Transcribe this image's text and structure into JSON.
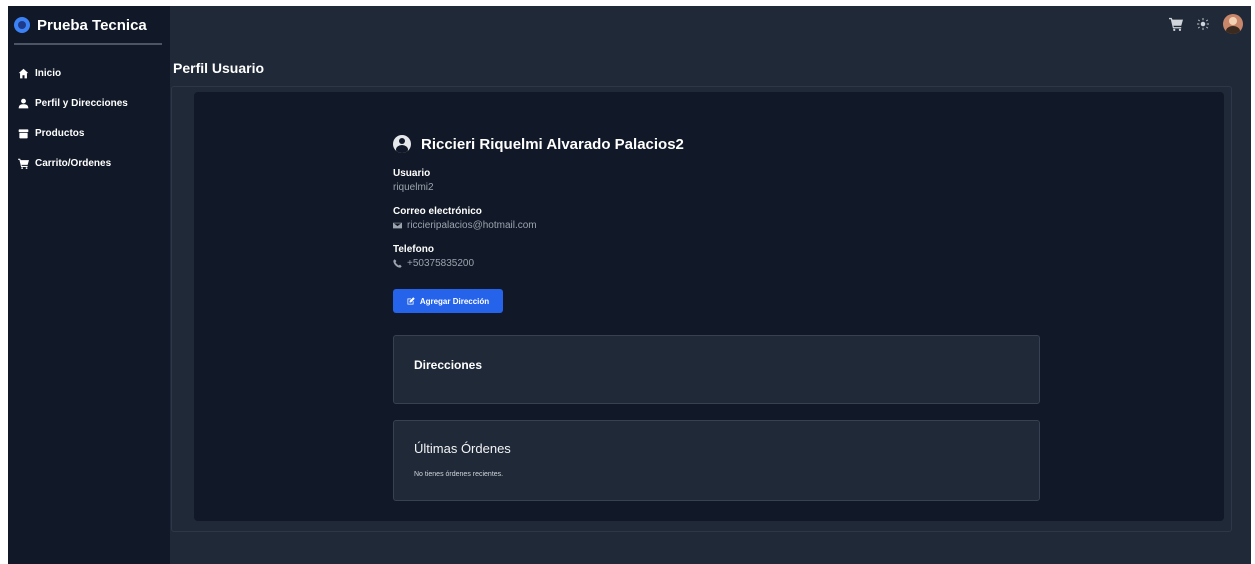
{
  "app": {
    "brand": "Prueba Tecnica"
  },
  "sidebar": {
    "items": [
      {
        "label": "Inicio",
        "icon": "home-icon"
      },
      {
        "label": "Perfil y Direcciones",
        "icon": "user-icon"
      },
      {
        "label": "Productos",
        "icon": "box-icon"
      },
      {
        "label": "Carrito/Ordenes",
        "icon": "cart-icon"
      }
    ]
  },
  "topbar": {
    "icons": [
      "cart-icon",
      "sun-icon",
      "avatar"
    ]
  },
  "main": {
    "page_title": "Perfil Usuario",
    "profile": {
      "name": "Riccieri Riquelmi Alvarado Palacios2",
      "user_label": "Usuario",
      "user_value": "riquelmi2",
      "email_label": "Correo electrónico",
      "email_value": "riccieripalacios@hotmail.com",
      "phone_label": "Telefono",
      "phone_value": "+50375835200"
    },
    "add_address_button": "Agregar Dirección",
    "addresses": {
      "title": "Direcciones"
    },
    "orders": {
      "title": "Últimas Órdenes",
      "empty_text": "No tienes órdenes recientes."
    }
  },
  "colors": {
    "sidebar_bg": "#111827",
    "main_bg": "#1f2937",
    "panel_bg": "#111827",
    "accent": "#2563eb"
  }
}
